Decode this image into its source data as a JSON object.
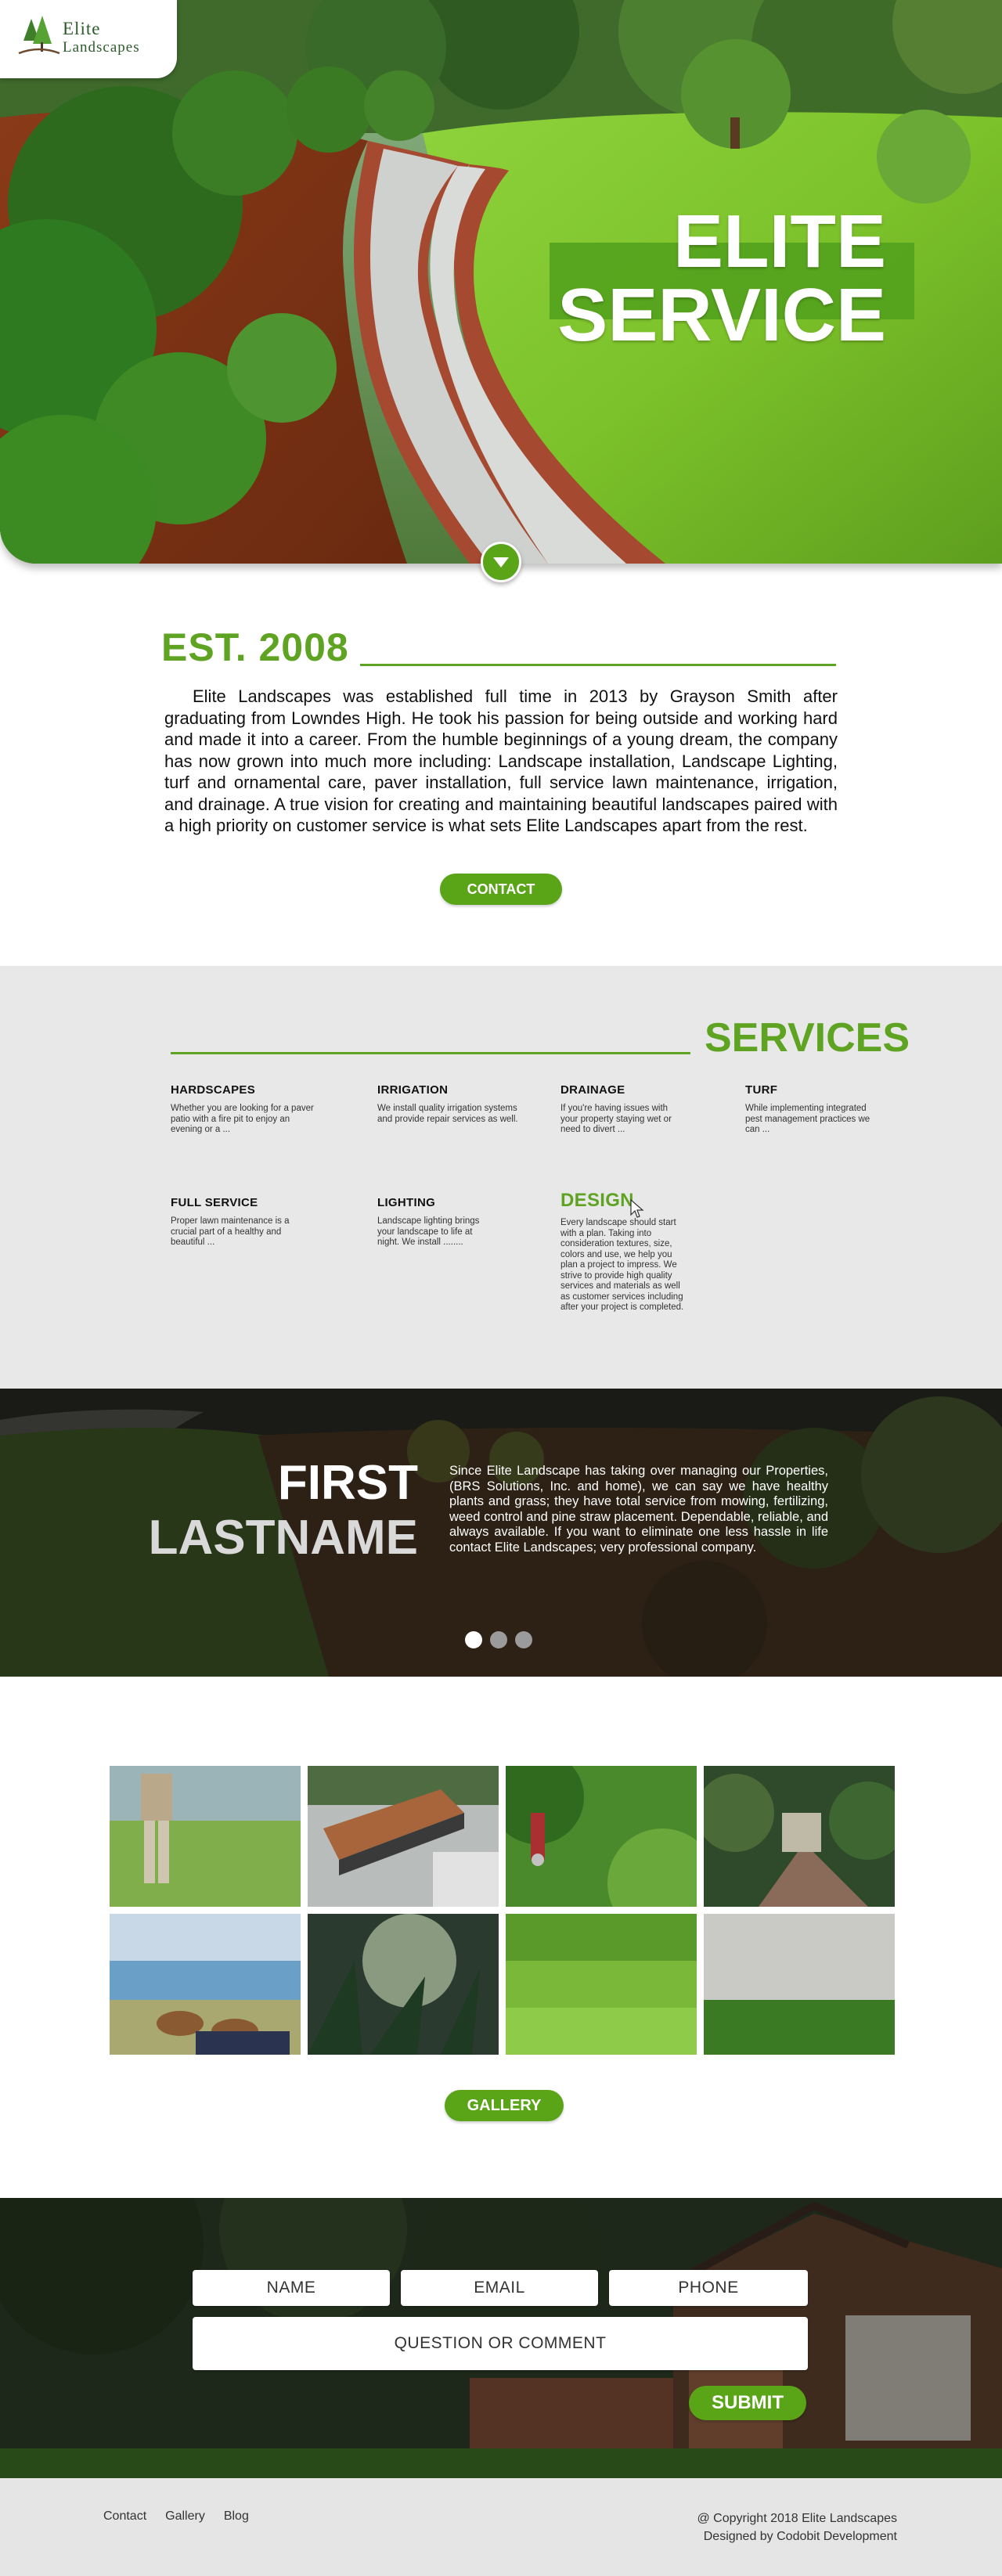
{
  "brand": {
    "logo_line1": "Elite",
    "logo_line2": "Landscapes"
  },
  "hero": {
    "title_line1": "ELITE",
    "title_line2": "SERVICE"
  },
  "about": {
    "heading": "EST.  2008",
    "body": "Elite Landscapes was established full time in 2013 by Grayson Smith after graduating from Lowndes High. He took his passion for being outside and working hard and made it into a career. From the humble beginnings of a young dream, the company has now grown into much more including: Landscape installation, Landscape Lighting, turf and ornamental care, paver installation, full service lawn maintenance, irrigation, and drainage. A true vision for creating and maintaining beautiful landscapes paired with a high priority on customer service is what sets Elite Landscapes apart from the rest.",
    "contact_label": "CONTACT"
  },
  "services": {
    "title": "SERVICES",
    "items": [
      {
        "title": "HARDSCAPES",
        "text": "Whether you are looking for a paver patio with a fire pit to enjoy an evening or a ..."
      },
      {
        "title": "IRRIGATION",
        "text": "We install quality irrigation systems and provide repair services as well."
      },
      {
        "title": "DRAINAGE",
        "text": "If you're having issues with your property staying wet or need to divert ..."
      },
      {
        "title": "TURF",
        "text": "While implementing integrated pest management practices we can  ..."
      },
      {
        "title": "FULL SERVICE",
        "text": "Proper lawn maintenance is a crucial part of a healthy and beautiful ..."
      },
      {
        "title": "LIGHTING",
        "text": "Landscape lighting brings your landscape to life at night. We install ........"
      },
      {
        "title": "DESIGN",
        "text": "Every landscape should start with a plan. Taking into consideration textures, size, colors and use, we help you plan a project to impress. We strive to provide high quality services and materials as well as customer services including after your project is completed."
      }
    ]
  },
  "testimonial": {
    "name_line1": "FIRST",
    "name_line2": "LASTNAME",
    "quote": "Since Elite Landscape has taking over managing our Properties, (BRS Solutions, Inc. and home), we can say we have healthy plants and grass; they have total service from mowing, fertilizing, weed control and pine straw placement. Dependable, reliable, and always available. If you want to eliminate one less hassle in life contact Elite Landscapes; very professional company.",
    "slides": 3,
    "active_slide": 1
  },
  "gallery": {
    "button_label": "GALLERY"
  },
  "contact_form": {
    "name_placeholder": "NAME",
    "email_placeholder": "EMAIL",
    "phone_placeholder": "PHONE",
    "comment_placeholder": "QUESTION OR COMMENT",
    "submit_label": "SUBMIT"
  },
  "footer": {
    "links": [
      "Contact",
      "Gallery",
      "Blog"
    ],
    "copyright": "@ Copyright 2018 Elite Landscapes",
    "designed_by": "Designed by Codobit Development"
  },
  "colors": {
    "brand_green": "#5aa417",
    "services_bg": "#e8e8e8",
    "footer_bg": "#e5e5e5"
  }
}
